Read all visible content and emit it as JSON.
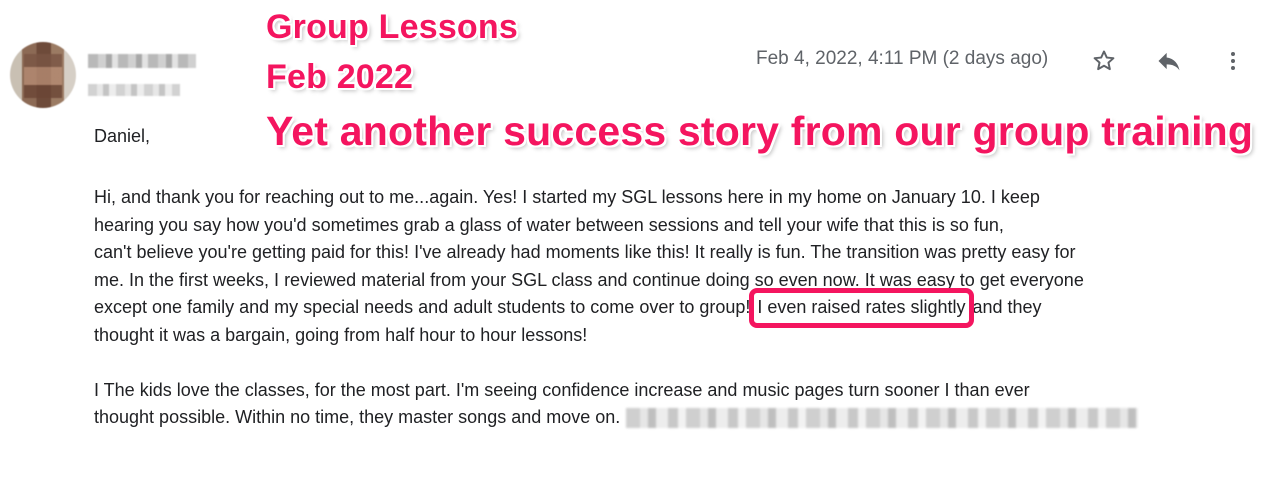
{
  "annotation": {
    "line1": "Group Lessons",
    "line2": "Feb 2022",
    "line3": "Yet another success story from our group training",
    "color": "#f4155f"
  },
  "header": {
    "timestamp": "Feb 4, 2022, 4:11 PM (2 days ago)",
    "icons": [
      "star-icon",
      "reply-icon",
      "more-vert-icon"
    ]
  },
  "email": {
    "greeting": "Daniel,",
    "para1": {
      "l1": "Hi, and thank you for reaching out to me...again.  Yes!  I started my SGL lessons here in my home on January 10.  I keep",
      "l2": "hearing you say how you'd sometimes grab a glass of water between sessions and tell your wife that this is so fun,",
      "l3": "can't believe you're getting paid for this!  I've already had moments like this!  It really is fun. The transition was pretty easy for",
      "l4": "me.  In the first weeks, I reviewed material from your SGL class and continue doing so even now.  It was easy to get everyone",
      "l5_before": "except one family and my special needs and adult students to come over to group! ",
      "l5_highlight": "I even raised rates slightly",
      "l5_after": " and they",
      "l6": "thought it was a bargain, going from half hour to hour lessons!"
    },
    "para2": {
      "l1": "I The kids love the classes, for the most part.  I'm seeing confidence increase and music pages turn sooner I than ever",
      "l2": "thought possible.  Within no time, they master songs and move on."
    }
  }
}
